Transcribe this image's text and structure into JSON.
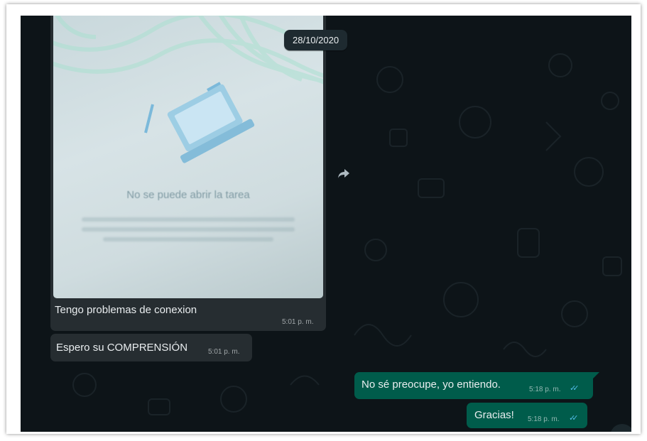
{
  "chat": {
    "date_chip": "28/10/2020",
    "messages": [
      {
        "direction": "incoming",
        "type": "image",
        "image_text": "No se puede abrir la tarea",
        "caption": "Tengo problemas de conexion",
        "time": "5:01 p. m."
      },
      {
        "direction": "incoming",
        "type": "text",
        "text": "Espero su COMPRENSIÓN",
        "time": "5:01 p. m."
      },
      {
        "direction": "outgoing",
        "type": "text",
        "text": "No sé preocupe, yo entiendo.",
        "time": "5:18 p. m.",
        "status": "read"
      },
      {
        "direction": "outgoing",
        "type": "text",
        "text": "Gracias!",
        "time": "5:18 p. m.",
        "status": "read"
      }
    ]
  },
  "icons": {
    "forward": "forward-icon",
    "read_receipt": "double-check-icon"
  },
  "colors": {
    "background": "#0d1418",
    "incoming_bubble": "#262d31",
    "outgoing_bubble": "#005c4b",
    "read_ticks": "#53bdeb"
  }
}
